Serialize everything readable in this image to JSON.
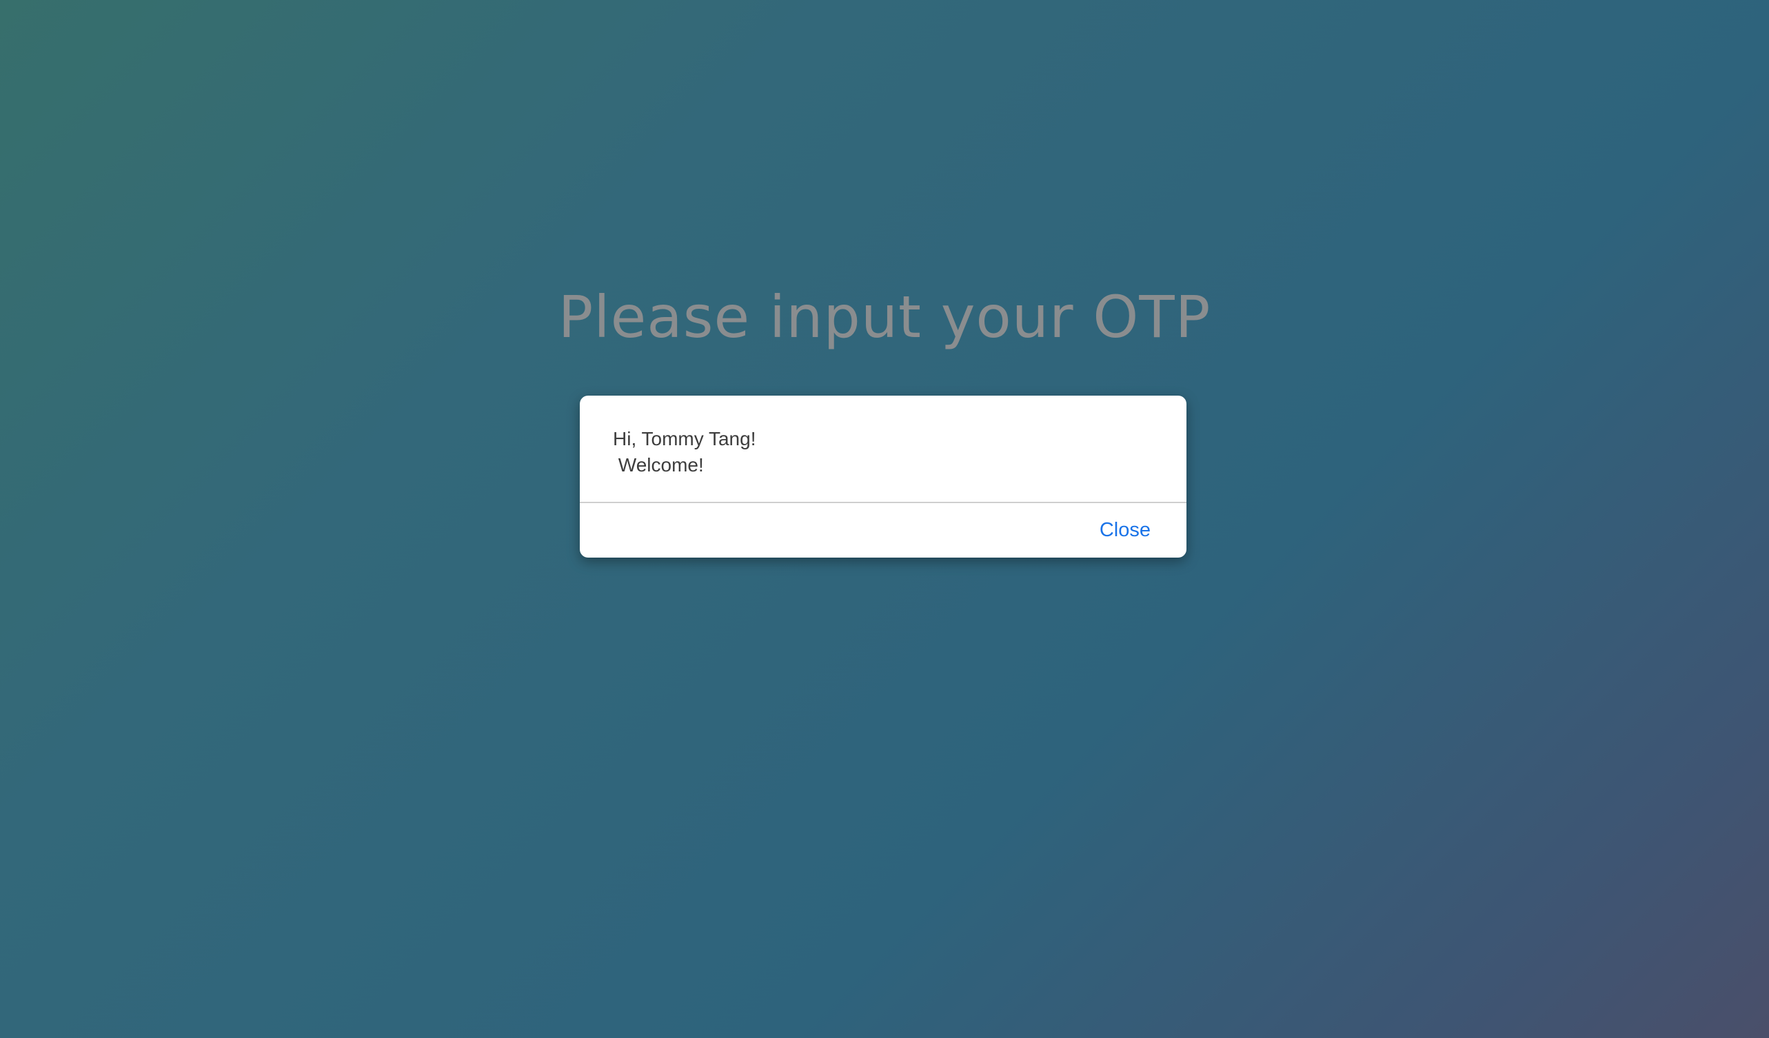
{
  "page": {
    "title": "Please input your OTP"
  },
  "dialog": {
    "line1": "Hi, Tommy Tang!",
    "line2": " Welcome!",
    "close_label": "Close"
  },
  "colors": {
    "accent": "#1a73e8",
    "title": "#8a8d8f",
    "text": "#3d3d3d"
  }
}
